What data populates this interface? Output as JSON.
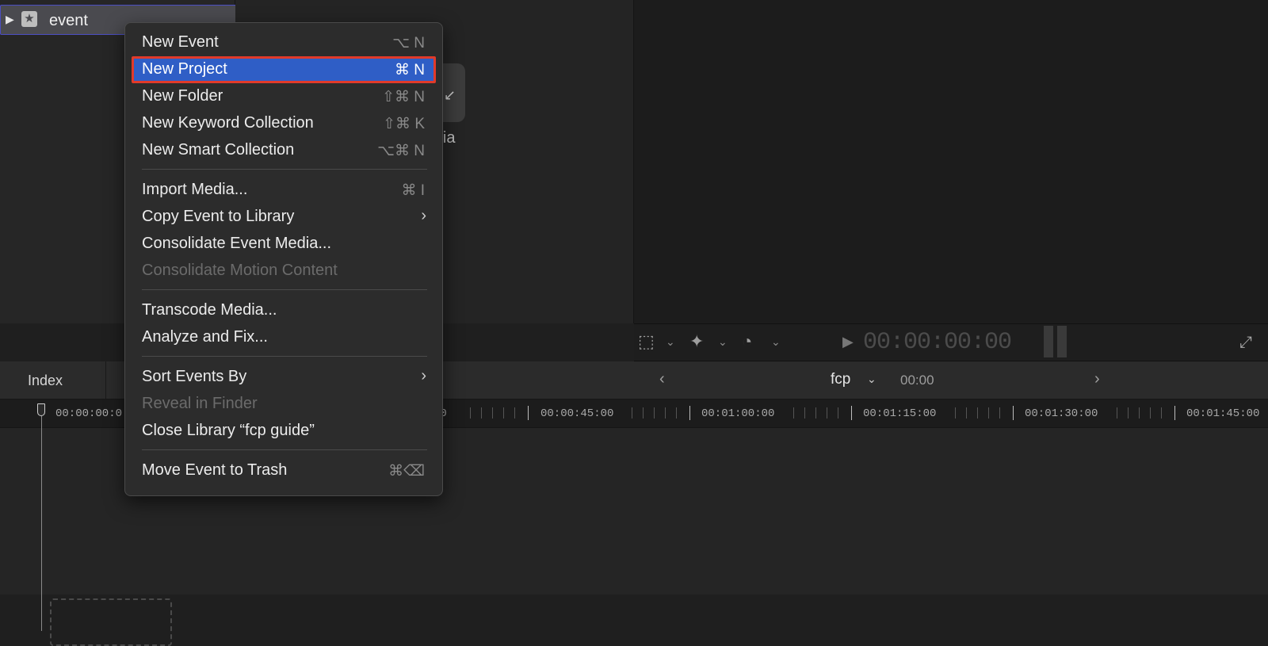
{
  "sidebar": {
    "event_label": "event"
  },
  "browser": {
    "import_label": "Media"
  },
  "viewer": {
    "timecode": "00:00:00:00"
  },
  "timeline_toolbar": {
    "index_label": "Index",
    "project_name": "fcp",
    "project_time": "00:00"
  },
  "ruler": {
    "labels": [
      "00:00:00:0",
      "00",
      "00:00:45:00",
      "00:01:00:00",
      "00:01:15:00",
      "00:01:30:00",
      "00:01:45:00"
    ]
  },
  "context_menu": {
    "items": [
      {
        "label": "New Event",
        "shortcut": "⌥ N"
      },
      {
        "label": "New Project",
        "shortcut": "⌘ N"
      },
      {
        "label": "New Folder",
        "shortcut": "⇧⌘ N"
      },
      {
        "label": "New Keyword Collection",
        "shortcut": "⇧⌘ K"
      },
      {
        "label": "New Smart Collection",
        "shortcut": "⌥⌘ N"
      },
      {
        "label": "Import Media...",
        "shortcut": "⌘ I"
      },
      {
        "label": "Copy Event to Library",
        "shortcut": ""
      },
      {
        "label": "Consolidate Event Media...",
        "shortcut": ""
      },
      {
        "label": "Consolidate Motion Content",
        "shortcut": ""
      },
      {
        "label": "Transcode Media...",
        "shortcut": ""
      },
      {
        "label": "Analyze and Fix...",
        "shortcut": ""
      },
      {
        "label": "Sort Events By",
        "shortcut": ""
      },
      {
        "label": "Reveal in Finder",
        "shortcut": ""
      },
      {
        "label": "Close Library “fcp guide”",
        "shortcut": ""
      },
      {
        "label": "Move Event to Trash",
        "shortcut": "⌘⌫"
      }
    ]
  }
}
